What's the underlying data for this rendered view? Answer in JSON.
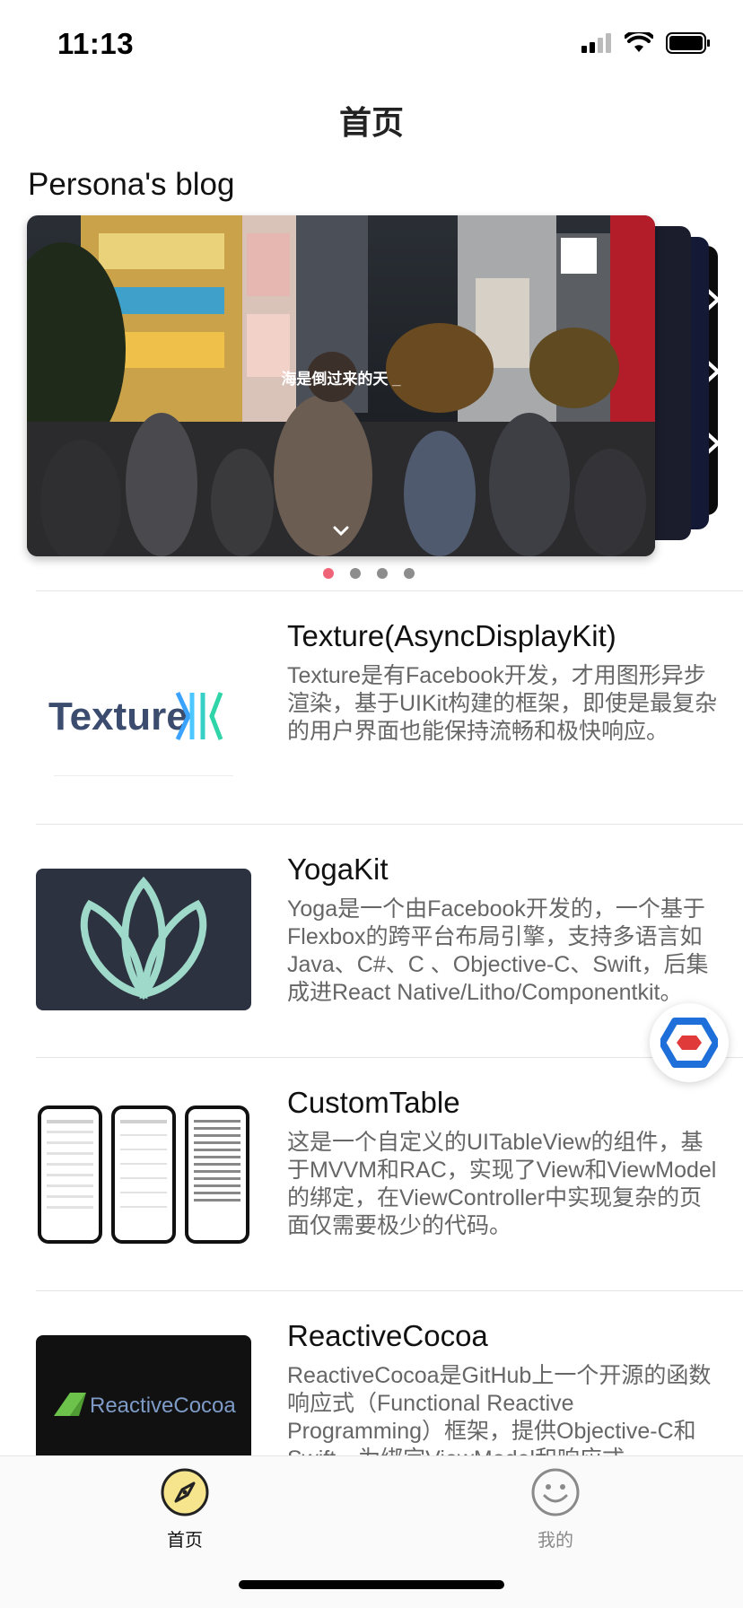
{
  "status_bar": {
    "time": "11:13",
    "icons": [
      "signal-icon",
      "wifi-icon",
      "battery-icon"
    ]
  },
  "nav": {
    "title": "首页"
  },
  "blog_title": "Persona's blog",
  "banner": {
    "caption": "海是倒过来的天 _",
    "page_count": 4,
    "active_page": 1
  },
  "items": [
    {
      "title": "Texture(AsyncDisplayKit)",
      "description": "Texture是有Facebook开发，才用图形异步渲染，基于UIKit构建的框架，即使是最复杂的用户界面也能保持流畅和极快响应。",
      "thumb_text": "Texture"
    },
    {
      "title": "YogaKit",
      "description": "Yoga是一个由Facebook开发的，一个基于Flexbox的跨平台布局引擎，支持多语言如Java、C#、C 、Objective-C、Swift，后集成进React Native/Litho/Componentkit。",
      "thumb_text": ""
    },
    {
      "title": "CustomTable",
      "description": "这是一个自定义的UITableView的组件，基于MVVM和RAC，实现了View和ViewModel的绑定，在ViewController中实现复杂的页面仅需要极少的代码。",
      "thumb_text": ""
    },
    {
      "title": "ReactiveCocoa",
      "description": "ReactiveCocoa是GitHub上一个开源的函数响应式（Functional Reactive Programming）框架，提供Objective-C和Swift，为绑定ViewModel和响应式",
      "thumb_text": "ReactiveCocoa"
    }
  ],
  "tab_bar": {
    "tabs": [
      {
        "label": "首页",
        "icon": "compass-icon",
        "active": true
      },
      {
        "label": "我的",
        "icon": "smiley-icon",
        "active": false
      }
    ]
  },
  "colors": {
    "accent_dot": "#f06478",
    "tab_active_fill": "#f6e58d",
    "yoga_bg": "#2d3240",
    "yoga_leaf": "#9ed9c9"
  }
}
